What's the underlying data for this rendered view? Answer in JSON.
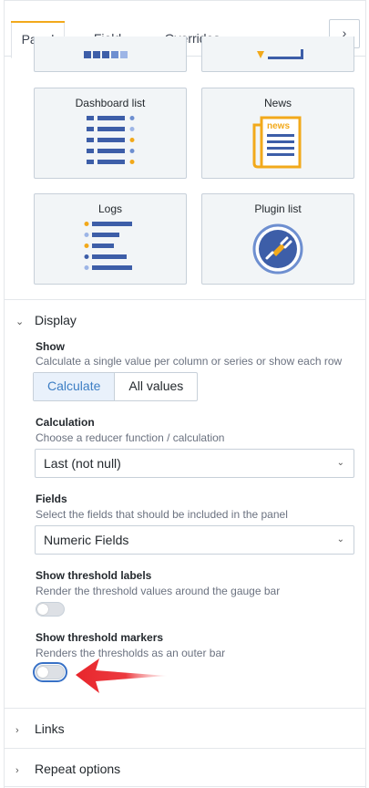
{
  "tabs": [
    {
      "label": "Panel",
      "active": true
    },
    {
      "label": "Field",
      "active": false
    },
    {
      "label": "Overrides",
      "active": false
    }
  ],
  "tab_next_icon": "chevron-right-icon",
  "viz_cards": [
    {
      "title": "Dashboard list",
      "icon": "dashboard-list-icon"
    },
    {
      "title": "News",
      "icon": "news-icon"
    },
    {
      "title": "Logs",
      "icon": "logs-icon"
    },
    {
      "title": "Plugin list",
      "icon": "plugin-list-icon"
    }
  ],
  "display": {
    "header": "Display",
    "show": {
      "label": "Show",
      "description": "Calculate a single value per column or series or show each row",
      "options": [
        "Calculate",
        "All values"
      ],
      "selected": "Calculate"
    },
    "calculation": {
      "label": "Calculation",
      "description": "Choose a reducer function / calculation",
      "value": "Last (not null)"
    },
    "fields": {
      "label": "Fields",
      "description": "Select the fields that should be included in the panel",
      "value": "Numeric Fields"
    },
    "threshold_labels": {
      "label": "Show threshold labels",
      "description": "Render the threshold values around the gauge bar",
      "enabled": false
    },
    "threshold_markers": {
      "label": "Show threshold markers",
      "description": "Renders the thresholds as an outer bar",
      "enabled": false
    }
  },
  "collapsed_groups": [
    "Links",
    "Repeat options"
  ],
  "colors": {
    "accent": "#f2a91b",
    "blue": "#3d5ea8",
    "annotation_arrow": "#e8262c"
  }
}
